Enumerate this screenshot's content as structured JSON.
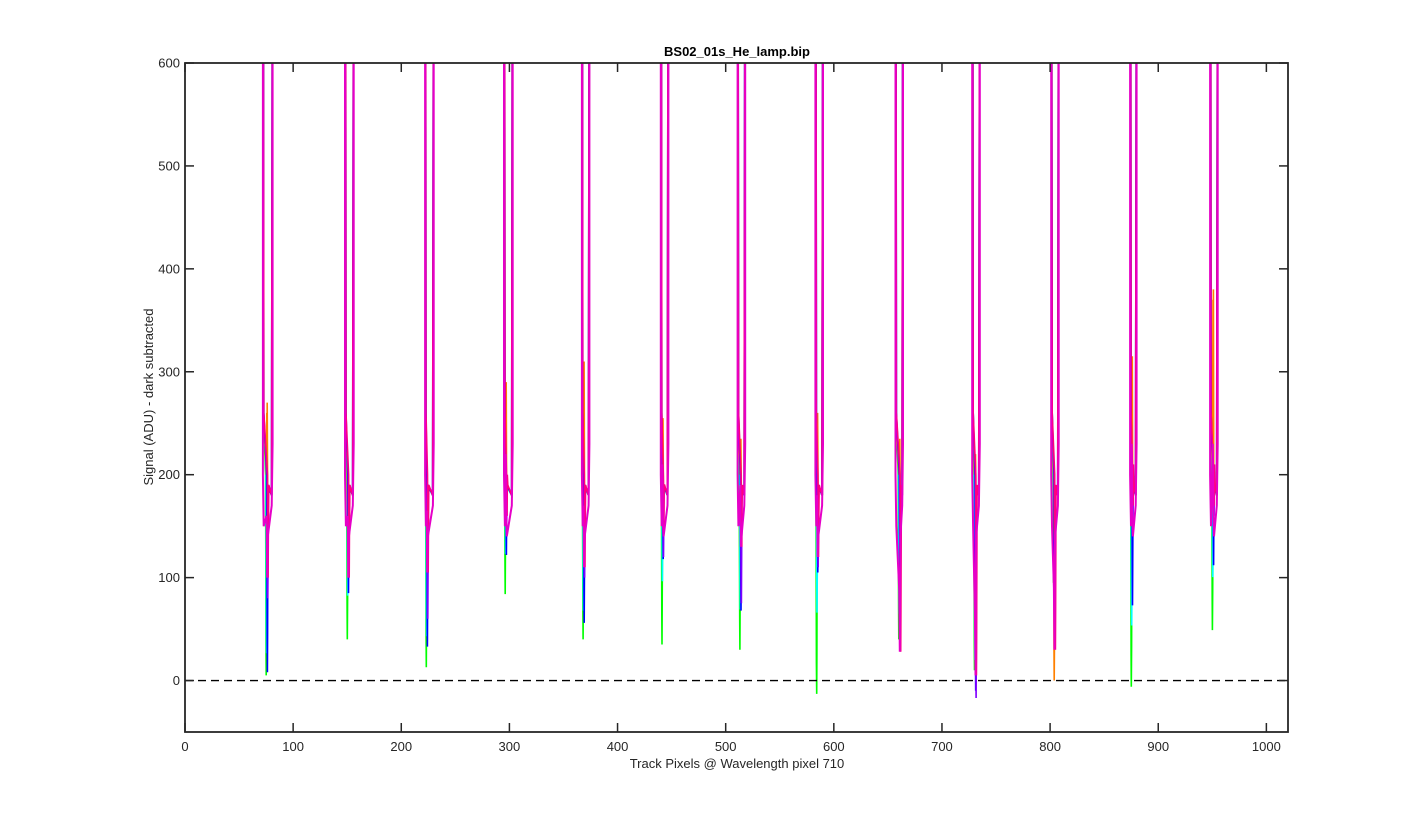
{
  "chart_data": {
    "type": "line",
    "title": "BS02_01s_He_lamp.bip",
    "xlabel": "Track Pixels @ Wavelength pixel 710",
    "ylabel": "Signal (ADU) - dark subtracted",
    "xlim": [
      0,
      1020
    ],
    "ylim": [
      -50,
      600
    ],
    "xticks": [
      0,
      100,
      200,
      300,
      400,
      500,
      600,
      700,
      800,
      900,
      1000
    ],
    "yticks": [
      0,
      100,
      200,
      300,
      400,
      500,
      600
    ],
    "grid": false,
    "legend": "none",
    "zero_reference_line": {
      "y": 0,
      "style": "dashed",
      "color": "#000000"
    },
    "series_colors": [
      "#00ff00",
      "#00ffff",
      "#ff8000",
      "#0000ff",
      "#8000ff",
      "#ff0080",
      "#ff00ff",
      "#cc00cc"
    ],
    "troughs": [
      {
        "left_edge": 72,
        "right_edge": 81,
        "min_x": 76,
        "min_value": 8,
        "values": {
          "blue": 8,
          "magenta": 80,
          "pink": 100,
          "green": 5,
          "orange": 230
        }
      },
      {
        "left_edge": 148,
        "right_edge": 156,
        "min_x": 151,
        "min_value": 40,
        "values": {
          "blue": 85,
          "magenta": 100,
          "pink": 100,
          "green": 40,
          "orange": 100
        }
      },
      {
        "left_edge": 222,
        "right_edge": 230,
        "min_x": 224,
        "min_value": 13,
        "values": {
          "blue": 33,
          "magenta": 60,
          "pink": 105,
          "green": 13,
          "orange": 110
        }
      },
      {
        "left_edge": 295,
        "right_edge": 303,
        "min_x": 297,
        "min_value": 84,
        "values": {
          "blue": 122,
          "magenta": 150,
          "pink": 160,
          "green": 84,
          "orange": 250
        }
      },
      {
        "left_edge": 367,
        "right_edge": 374,
        "min_x": 369,
        "min_value": 40,
        "values": {
          "blue": 56,
          "magenta": 100,
          "pink": 110,
          "green": 40,
          "orange": 270
        }
      },
      {
        "left_edge": 440,
        "right_edge": 447,
        "min_x": 442,
        "min_value": 35,
        "values": {
          "blue": 118,
          "magenta": 120,
          "pink": 150,
          "green": 35,
          "orange": 215
        }
      },
      {
        "left_edge": 511,
        "right_edge": 518,
        "min_x": 514,
        "min_value": 30,
        "values": {
          "blue": 68,
          "magenta": 75,
          "pink": 130,
          "green": 30,
          "orange": 195
        }
      },
      {
        "left_edge": 583,
        "right_edge": 590,
        "min_x": 585,
        "min_value": -13,
        "values": {
          "blue": 105,
          "magenta": 110,
          "pink": 120,
          "green": -13,
          "orange": 220
        }
      },
      {
        "left_edge": 657,
        "right_edge": 664,
        "min_x": 661,
        "min_value": 28,
        "values": {
          "blue": 50,
          "magenta": 45,
          "pink": 28,
          "green": 40,
          "orange": 195
        }
      },
      {
        "left_edge": 728,
        "right_edge": 735,
        "min_x": 731,
        "min_value": -17,
        "values": {
          "blue": -10,
          "magenta": -17,
          "pink": 5,
          "green": 10,
          "orange": 180
        }
      },
      {
        "left_edge": 801,
        "right_edge": 808,
        "min_x": 804,
        "min_value": 0,
        "values": {
          "blue": 68,
          "magenta": 80,
          "pink": 30,
          "green": 95,
          "orange": 0
        }
      },
      {
        "left_edge": 874,
        "right_edge": 880,
        "min_x": 876,
        "min_value": -6,
        "values": {
          "blue": 73,
          "magenta": 150,
          "pink": 170,
          "green": -6,
          "orange": 275
        }
      },
      {
        "left_edge": 948,
        "right_edge": 955,
        "min_x": 951,
        "min_value": 49,
        "values": {
          "blue": 112,
          "magenta": 160,
          "pink": 170,
          "green": 49,
          "orange": 340
        }
      }
    ]
  }
}
